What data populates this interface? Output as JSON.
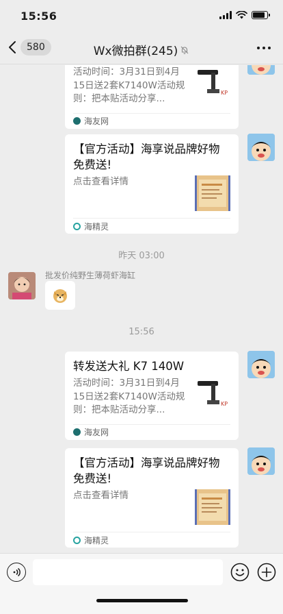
{
  "status_bar": {
    "time": "15:56",
    "icons": [
      "signal-icon",
      "wifi-icon",
      "battery-icon"
    ],
    "battery_level": 0.85
  },
  "nav": {
    "back_count": "580",
    "title": "Wx微拍群(245)",
    "icons": [
      "chevron-left-icon",
      "mute-bell-icon",
      "more-icon"
    ]
  },
  "messages": [
    {
      "type": "link_card_partial",
      "desc": "活动时间：3月31日到4月15日送2套K7140W活动规则：把本贴活动分享...",
      "source": "海友网"
    },
    {
      "type": "link_card",
      "title": "【官方活动】海享说品牌好物免费送!",
      "desc": "点击查看详情",
      "source": "海精灵"
    },
    {
      "type": "time",
      "text": "昨天 03:00"
    },
    {
      "type": "sticker",
      "sender": "批发价纯野生薄荷虾海缸",
      "sticker": "doge-sticker"
    },
    {
      "type": "time",
      "text": "15:56"
    },
    {
      "type": "link_card",
      "title": "转发送大礼 K7 140W",
      "desc": "活动时间：3月31日到4月15日送2套K7140W活动规则：把本贴活动分享...",
      "source": "海友网"
    },
    {
      "type": "link_card",
      "title": "【官方活动】海享说品牌好物免费送!",
      "desc": "点击查看详情",
      "source": "海精灵"
    }
  ],
  "input_bar": {
    "value": "",
    "icons": [
      "voice-icon",
      "emoji-icon",
      "plus-icon"
    ]
  },
  "colors": {
    "bg": "#ededed",
    "card": "#ffffff",
    "source_haiyou": "#1e6f6f",
    "source_haijingling": "#27a3a0"
  }
}
